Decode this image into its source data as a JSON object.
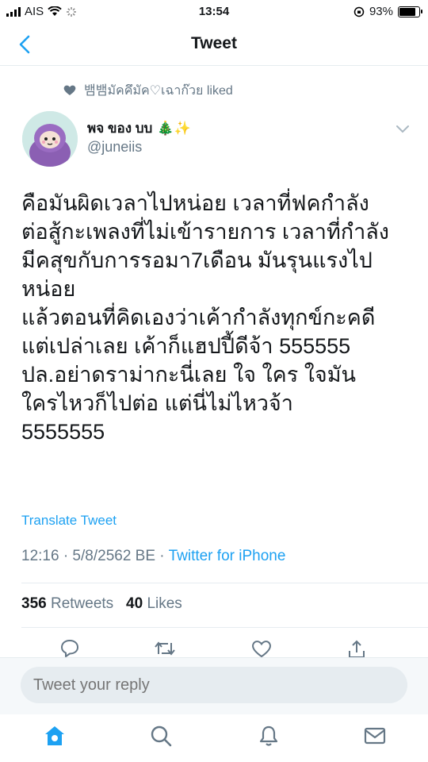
{
  "status_bar": {
    "carrier": "AIS",
    "time": "13:54",
    "battery": "93%",
    "battery_level": 0.93
  },
  "nav": {
    "title": "Tweet"
  },
  "context": {
    "liked_text": "뱀뱀มัคคึมัค♡เฉาก๊วย liked"
  },
  "author": {
    "display_name": "พจ ของ บบ",
    "emoji": "🎄✨",
    "username": "@juneiis"
  },
  "tweet": {
    "lines": [
      "คือมันผิดเวลาไปหน่อย เวลาที่ฟคกำลัง",
      "ต่อสู้กะเพลงที่ไม่เข้ารายการ เวลาที่กำลัง",
      "มีคสุขกับการรอมา7เดือน มันรุนแรงไป",
      "หน่อย",
      "แล้วตอนที่คิดเองว่าเค้ากำลังทุกข์กะคดี",
      "แต่เปล่าเลย เค้าก็แฮปปี้ดีจ้า 555555",
      "ปล.อย่าดราม่ากะนี่เลย  ใจ ใคร ใจมัน",
      " ใครไหวก็ไปต่อ แต่นี่ไม่ไหวจ้า",
      "5555555"
    ],
    "translate_label": "Translate Tweet",
    "timestamp": "12:16 · 5/8/2562 BE · ",
    "source": "Twitter for iPhone"
  },
  "stats": {
    "retweets": "356",
    "retweets_label": "Retweets",
    "likes": "40",
    "likes_label": "Likes"
  },
  "reply": {
    "placeholder": "Tweet your reply"
  },
  "colors": {
    "accent": "#1da1f2",
    "secondary_text": "#657786",
    "divider": "#e6ecf0"
  }
}
